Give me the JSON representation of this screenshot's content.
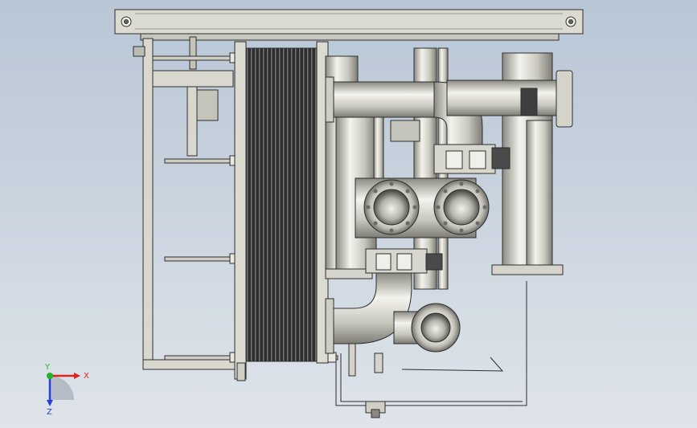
{
  "triad": {
    "x_label": "X",
    "y_label": "Y",
    "z_label": "Z",
    "colors": {
      "x": "#e0231c",
      "y": "#22b422",
      "z": "#2a3fd6"
    }
  },
  "palette": {
    "steel_light": "#f2f2ec",
    "steel_mid": "#c9c8bf",
    "steel_dark": "#8b8a82",
    "frame": "#d9d8cf",
    "outline": "#2e2e2e",
    "plates": "#3b3b3b"
  }
}
